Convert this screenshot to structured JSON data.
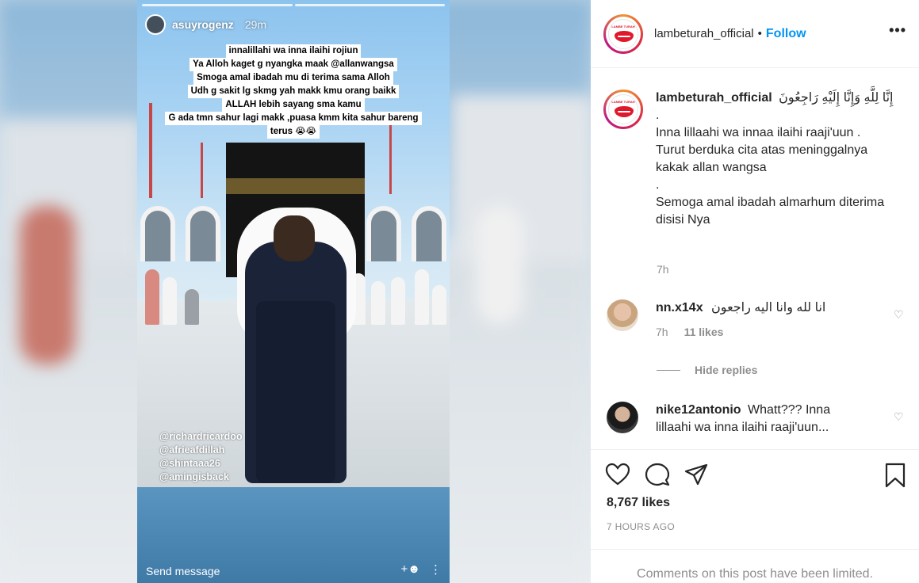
{
  "story": {
    "username": "asuyrogenz",
    "time": "29m",
    "text_lines": [
      "innalillahi wa inna ilaihi rojiun",
      "Ya Alloh kaget g nyangka maak @allanwangsa",
      "Smoga amal ibadah mu di terima sama Alloh",
      "Udh g sakit lg skmg yah makk kmu orang baikk",
      "ALLAH lebih sayang sma kamu",
      "G ada tmn sahur lagi makk ,puasa kmm kita sahur bareng",
      "terus 😭😭"
    ],
    "tags": [
      "@richardricardoo",
      "@afrieafdillah",
      "@shintaaa26",
      "@amingisback"
    ],
    "send_message": "Send message"
  },
  "header": {
    "username": "lambeturah_official",
    "separator": "•",
    "follow_label": "Follow",
    "logo_text": "LAMBE TURAH",
    "more_label": "•••"
  },
  "caption": {
    "username": "lambeturah_official",
    "arabic": "إِنَّا لِلَّهِ وَإِنَّا إِلَيْهِ رَاجِعُونَ",
    "lines": [
      ".",
      "Inna lillaahi wa innaa ilaihi raaji'uun .",
      "Turut berduka cita atas meninggalnya kakak allan wangsa",
      ".",
      "Semoga amal ibadah almarhum diterima disisi Nya"
    ],
    "time": "7h"
  },
  "comments": [
    {
      "username": "nn.x14x",
      "text": "انا لله وانا اليه راجعون",
      "time": "7h",
      "likes": "11 likes"
    },
    {
      "username": "nike12antonio",
      "text": "Whatt??? Inna lillaahi wa inna ilaihi raaji'uun..."
    }
  ],
  "hide_replies": "Hide replies",
  "footer": {
    "likes": "8,767 likes",
    "posted": "7 HOURS AGO",
    "limited": "Comments on this post have been limited."
  }
}
